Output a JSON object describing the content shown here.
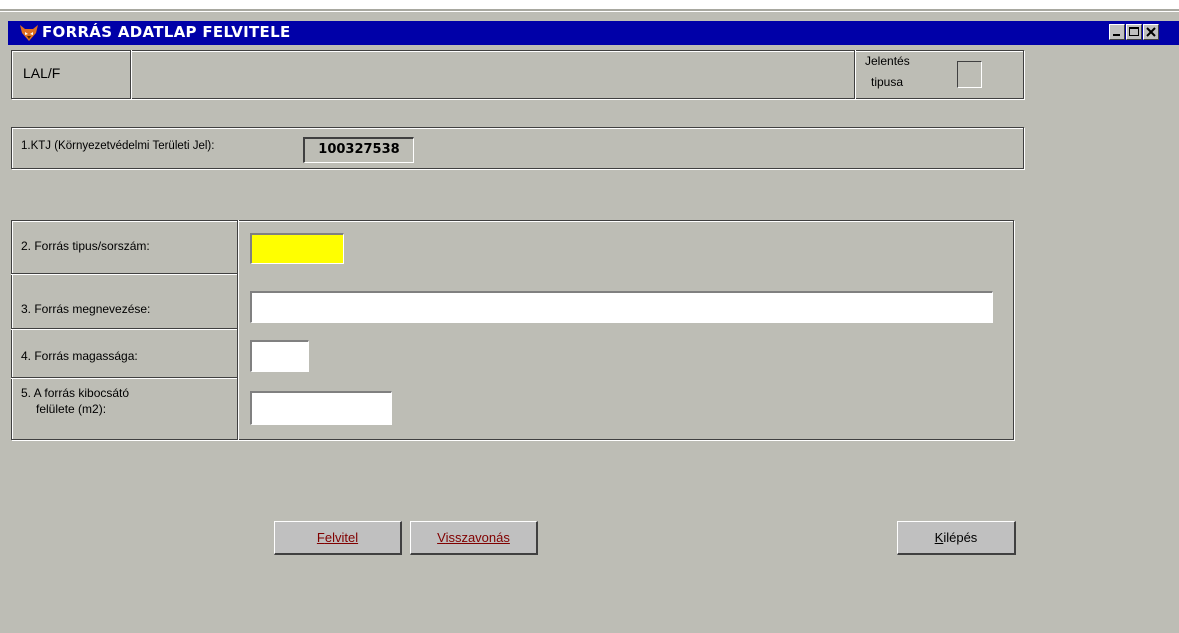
{
  "window": {
    "title": "FORRÁS ADATLAP FELVITELE",
    "icon": "fox-app-icon"
  },
  "header": {
    "form_code": "LAL/F",
    "report_type_label_line1": "Jelentés",
    "report_type_label_line2": "tipusa"
  },
  "ktj": {
    "label": "1.KTJ (Környezetvédelmi Területi Jel):",
    "value": "100327538"
  },
  "fields": {
    "type_number": {
      "label": "2. Forrás tipus/sorszám:",
      "value": ""
    },
    "name": {
      "label": "3. Forrás megnevezése:",
      "value": ""
    },
    "height": {
      "label": "4. Forrás magassága:",
      "value": ""
    },
    "surface_line1": "5. A forrás kibocsátó",
    "surface_line2": "felülete (m2):",
    "surface_value": ""
  },
  "buttons": {
    "submit": {
      "accel": "F",
      "rest": "elvitel"
    },
    "undo": {
      "accel": "V",
      "rest": "isszavonás"
    },
    "exit": {
      "accel": "K",
      "rest": "ilépés"
    }
  },
  "colors": {
    "titlebar": "#0000a8",
    "background": "#bdbdb5",
    "highlight_field": "#ffff00",
    "accelerator": "#800000"
  }
}
